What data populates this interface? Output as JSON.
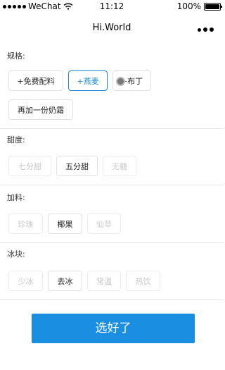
{
  "status_bar": {
    "carrier": "WeChat",
    "time": "11:12",
    "battery": "100%"
  },
  "nav": {
    "title": "Hi.World"
  },
  "sections": {
    "spec": {
      "label": "规格:",
      "options": [
        "+免费配料",
        "+燕麦",
        "+布丁",
        "再加一份奶霜"
      ]
    },
    "sweetness": {
      "label": "甜度:",
      "options": [
        "七分甜",
        "五分甜",
        "无糖"
      ]
    },
    "toppings": {
      "label": "加料:",
      "options": [
        "珍珠",
        "椰果",
        "仙草"
      ]
    },
    "ice": {
      "label": "冰块:",
      "options": [
        "少冰",
        "去冰",
        "常温",
        "热饮"
      ]
    }
  },
  "submit_label": "选好了",
  "colors": {
    "accent": "#1a8ee0",
    "selected": "#1a86d4",
    "disabled_text": "#c8c8c8"
  }
}
